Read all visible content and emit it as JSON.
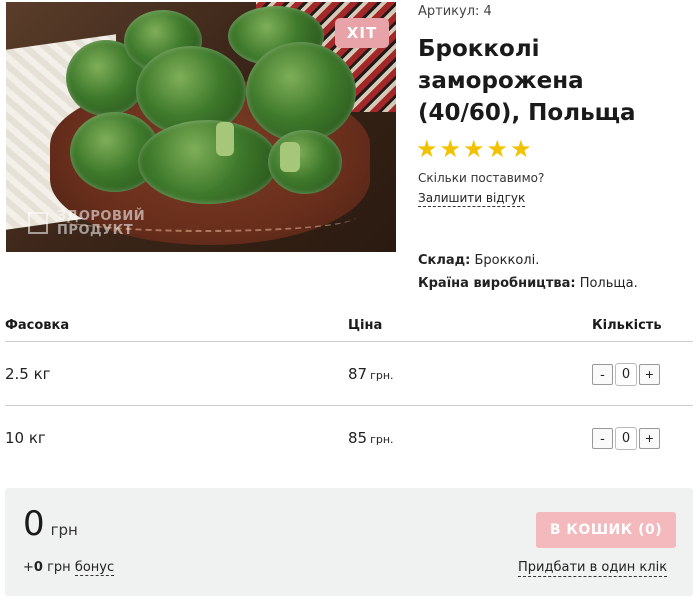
{
  "product": {
    "badge": "ХІТ",
    "sku": "Артикул: 4",
    "title": "Брокколі заморожена (40/60), Польща",
    "rating": {
      "stars": 5,
      "max": 5,
      "color": "#f2c200"
    },
    "rating_question": "Скільки поставимо?",
    "review_link": "Залишити відгук",
    "composition_label": "Склад:",
    "composition_value": "Брокколі.",
    "country_label": "Країна виробництва:",
    "country_value": "Польща."
  },
  "image_watermark": {
    "line1": "ЗДОРОВИЙ",
    "line2": "ПРОДУКТ"
  },
  "table": {
    "headers": {
      "pack": "Фасовка",
      "price": "Ціна",
      "qty": "Кількість"
    },
    "rows": [
      {
        "pack": "2.5 кг",
        "price": "87",
        "currency": "грн.",
        "qty": "0"
      },
      {
        "pack": "10 кг",
        "price": "85",
        "currency": "грн.",
        "qty": "0"
      }
    ],
    "minus": "-",
    "plus": "+"
  },
  "cart": {
    "total": "0",
    "total_currency": "грн",
    "bonus_prefix": "+",
    "bonus_amount": "0",
    "bonus_currency": "грн",
    "bonus_label": "бонус",
    "cart_button": "В КОШИК (0)",
    "one_click": "Придбати в один клік"
  },
  "colors": {
    "badge": "#e8a3a8",
    "cart_button": "#f3b9bd",
    "panel": "#f0f1f1"
  }
}
